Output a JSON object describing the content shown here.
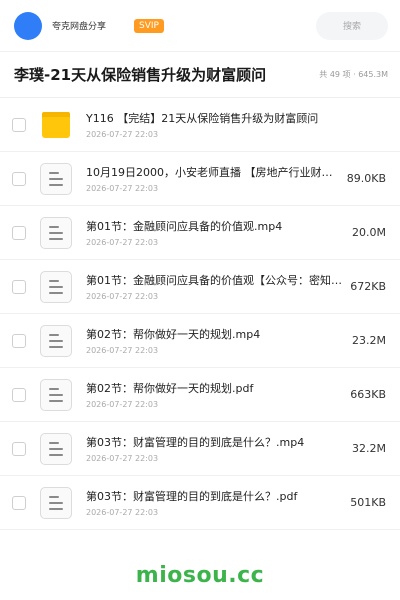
{
  "header": {
    "username": "夸克网盘分享",
    "badge": "SVIP",
    "search_placeholder": "搜索"
  },
  "folder": {
    "title": "李璞-21天从保险销售升级为财富顾问",
    "meta": "共 49 项 · 645.3M"
  },
  "files": [
    {
      "type": "folder",
      "name": "Y116 【完结】21天从保险销售升级为财富顾问",
      "date": "2026-07-27 22:03",
      "size": ""
    },
    {
      "type": "doc",
      "name": "10月19日2000，小安老师直播 【房地产行业财…",
      "date": "2026-07-27 22:03",
      "size": "89.0KB"
    },
    {
      "type": "doc",
      "name": "第01节：金融顾问应具备的价值观.mp4",
      "date": "2026-07-27 22:03",
      "size": "20.0M"
    },
    {
      "type": "doc",
      "name": "第01节：金融顾问应具备的价值观【公众号：密知圈】…",
      "date": "2026-07-27 22:03",
      "size": "672KB"
    },
    {
      "type": "doc",
      "name": "第02节：帮你做好一天的规划.mp4",
      "date": "2026-07-27 22:03",
      "size": "23.2M"
    },
    {
      "type": "doc",
      "name": "第02节：帮你做好一天的规划.pdf",
      "date": "2026-07-27 22:03",
      "size": "663KB"
    },
    {
      "type": "doc",
      "name": "第03节：财富管理的目的到底是什么？.mp4",
      "date": "2026-07-27 22:03",
      "size": "32.2M"
    },
    {
      "type": "doc",
      "name": "第03节：财富管理的目的到底是什么？.pdf",
      "date": "2026-07-27 22:03",
      "size": "501KB"
    }
  ],
  "footer": {
    "watermark": "miosou.cc"
  },
  "colors": {
    "accent": "#2f7ef7",
    "svip": "#ff9b21",
    "watermark": "#3cb44b",
    "folder": "#ffc60b"
  }
}
